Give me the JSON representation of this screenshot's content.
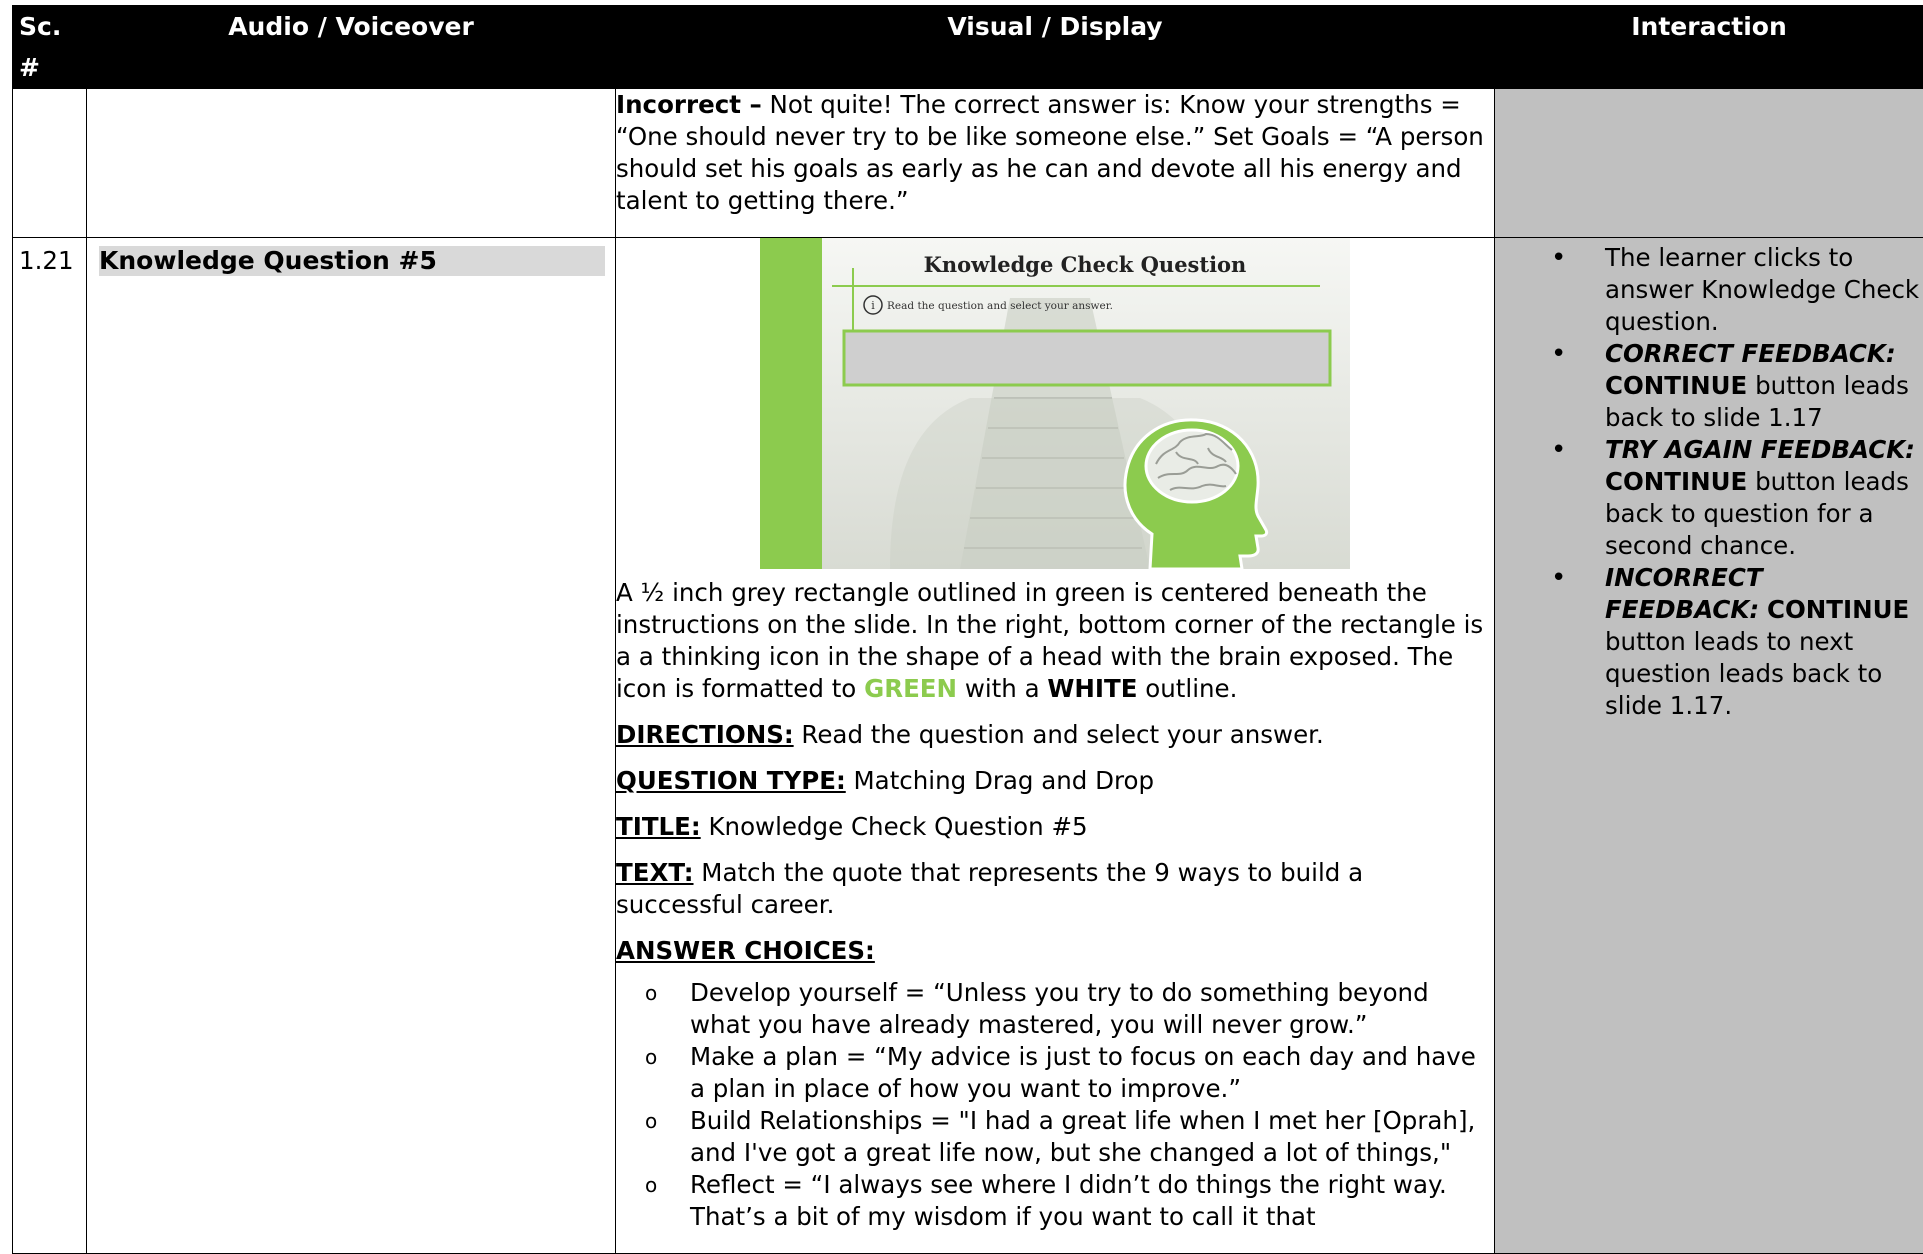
{
  "header": {
    "sc": "Sc. #",
    "audio": "Audio / Voiceover",
    "visual": "Visual / Display",
    "interaction": "Interaction"
  },
  "row_prev": {
    "incorrect_label": "Incorrect –",
    "incorrect_text": " Not quite! The correct answer is: Know your strengths = “One should never try to be like someone else.” Set Goals = “A person should set his goals as early as he can and devote all his energy and talent to getting there.”"
  },
  "row_main": {
    "sc_number": "1.21",
    "audio_title": "Knowledge Question #5",
    "slide": {
      "title": "Knowledge Check Question",
      "instruction": "Read the question and select your answer.",
      "info_glyph": "i"
    },
    "description": {
      "part1": "A ½ inch grey rectangle outlined in green is centered beneath the instructions on the slide. In the right, bottom corner of the rectangle is a a thinking icon in the shape of a head with the brain exposed. The icon is formatted to ",
      "green_word": "GREEN",
      "part2": " with a ",
      "white_word": "WHITE",
      "part3": " outline."
    },
    "directions_label": "DIRECTIONS:",
    "directions_text": " Read the question and select your answer.",
    "qtype_label": "QUESTION TYPE:",
    "qtype_text": " Matching Drag and Drop",
    "title_label": "TITLE:",
    "title_text": " Knowledge Check Question #5",
    "text_label": "TEXT:",
    "text_text": " Match the quote that represents the 9 ways to build a successful career.",
    "answer_choices_label": "ANSWER CHOICES:",
    "answer_bullet": "o",
    "answers": [
      "Develop yourself = “Unless you try to do something beyond what you have already mastered, you will never grow.”",
      "Make a plan = “My advice is just to focus on each day and have a plan in place of how you want to improve.”",
      "Build Relationships = \"I had a great life when I met her [Oprah], and I've got a great life now, but she changed a lot of things,\"",
      "Reflect = “I always see where I didn’t do things the right way. That’s a bit of my wisdom if you want to call it that"
    ],
    "interaction_bullet": "•",
    "interaction": {
      "item1": "The learner clicks to answer Knowledge Check question.",
      "item2_bi": "CORRECT FEEDBACK:",
      "item2_b": "CONTINUE",
      "item2_rest": " button leads back to slide 1.17",
      "item3_bi": "TRY AGAIN FEEDBACK:",
      "item3_b": "CONTINUE",
      "item3_rest": " button leads back to question for a second chance.",
      "item4_bi": "INCORRECT FEEDBACK:",
      "item4_b": "CONTINUE",
      "item4_rest": " button leads to next question leads back to slide 1.17."
    }
  },
  "colors": {
    "header_bg": "#000000",
    "interaction_bg": "#c0c0c0",
    "audio_title_bg": "#d9d9d9",
    "accent_green": "#8ccb4e"
  }
}
